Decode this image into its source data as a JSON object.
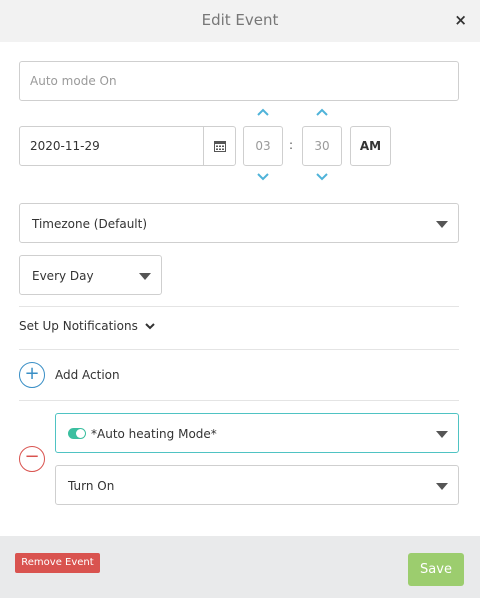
{
  "dialog": {
    "title": "Edit Event",
    "close_glyph": "×"
  },
  "event": {
    "name_placeholder": "Auto mode On",
    "date": "2020-11-29",
    "hour": "03",
    "minute": "30",
    "time_separator": ":",
    "ampm": "AM",
    "timezone": "Timezone (Default)",
    "repeat": "Every Day"
  },
  "notifications": {
    "label": "Set Up Notifications"
  },
  "actions": {
    "add_label": "Add Action",
    "add_glyph": "+",
    "remove_glyph": "−",
    "device": "*Auto heating Mode*",
    "command": "Turn On"
  },
  "footer": {
    "remove_label": "Remove Event",
    "save_label": "Save"
  },
  "icons": {
    "close": "close-icon",
    "calendar": "calendar-icon",
    "chevron_up": "chevron-up-icon",
    "chevron_down": "chevron-down-icon",
    "caret": "caret-down-icon",
    "toggle": "toggle-icon"
  },
  "colors": {
    "accent": "#3a8fc6",
    "chevron": "#4fb3d9",
    "danger": "#d9534f",
    "save": "#9ccd6e",
    "toggle": "#3bbfa0",
    "selected_border": "#4fc3c3"
  }
}
